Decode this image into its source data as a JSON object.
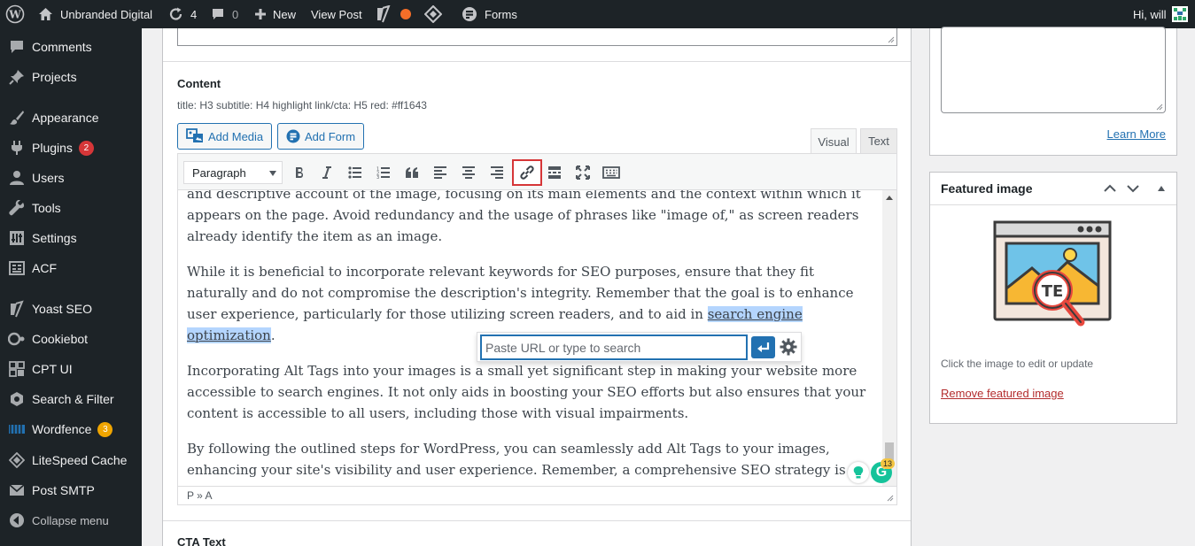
{
  "admin_bar": {
    "site_name": "Unbranded Digital",
    "updates_count": "4",
    "comments_count": "0",
    "new_label": "New",
    "view_post_label": "View Post",
    "forms_label": "Forms",
    "greeting": "Hi, will"
  },
  "sidebar": {
    "items": [
      {
        "label": "Comments",
        "icon": "comment-icon"
      },
      {
        "label": "Projects",
        "icon": "pin-icon"
      },
      {
        "label": "Appearance",
        "icon": "paintbrush-icon"
      },
      {
        "label": "Plugins",
        "icon": "plug-icon",
        "badge": "2"
      },
      {
        "label": "Users",
        "icon": "user-icon"
      },
      {
        "label": "Tools",
        "icon": "wrench-icon"
      },
      {
        "label": "Settings",
        "icon": "sliders-icon"
      },
      {
        "label": "ACF",
        "icon": "grid-icon"
      },
      {
        "label": "Yoast SEO",
        "icon": "yoast-icon"
      },
      {
        "label": "Cookiebot",
        "icon": "cookiebot-icon"
      },
      {
        "label": "CPT UI",
        "icon": "cpt-icon"
      },
      {
        "label": "Search & Filter",
        "icon": "search-filter-icon"
      },
      {
        "label": "Wordfence",
        "icon": "wordfence-icon",
        "badge": "3"
      },
      {
        "label": "LiteSpeed Cache",
        "icon": "diamond-icon"
      },
      {
        "label": "Post SMTP",
        "icon": "envelope-icon"
      },
      {
        "label": "Collapse menu",
        "icon": "collapse-icon"
      }
    ]
  },
  "content_field": {
    "label": "Content",
    "description": "title: H3 subtitle: H4 highlight link/cta: H5 red: #ff1643",
    "add_media_label": "Add Media",
    "add_form_label": "Add Form",
    "tab_visual": "Visual",
    "tab_text": "Text",
    "format_select": "Paragraph",
    "paragraphs": {
      "p1": "and descriptive account of the image, focusing on its main elements and the context within which it appears on the page. Avoid redundancy and the usage of phrases like \"image of,\" as screen readers already identify the item as an image.",
      "p2_before": "While it is beneficial to incorporate relevant keywords for SEO purposes, ensure that they fit naturally and do not compromise the description's integrity. Remember that the goal is to enhance user experience, particularly for those utilizing screen readers, and to aid in ",
      "p2_link": "search engine optimization",
      "p2_after": ".",
      "p3": "Incorporating Alt Tags into your images is a small yet significant step in making your website more accessible to search engines. It not only aids in boosting your SEO efforts but also ensures that your content is accessible to all users, including those with visual impairments.",
      "p4": "By following the outlined steps for WordPress, you can seamlessly add Alt Tags to your images, enhancing your site's visibility and user experience. Remember, a comprehensive SEO strategy is about paying attention to the details, and Alt Tags are an integral part of this puzzle."
    },
    "status_path": "P » A",
    "link_placeholder": "Paste URL or type to search",
    "grammarly_count": "13"
  },
  "next_field_label": "CTA Text",
  "excerpt_box": {
    "learn_more": "Learn More"
  },
  "featured_image": {
    "title": "Featured image",
    "note": "Click the image to edit or update",
    "remove_label": "Remove featured image"
  },
  "colors": {
    "admin_bg": "#1d2327",
    "link_blue": "#2271b1",
    "danger_red": "#d63638",
    "selection": "#b4d5fe"
  }
}
